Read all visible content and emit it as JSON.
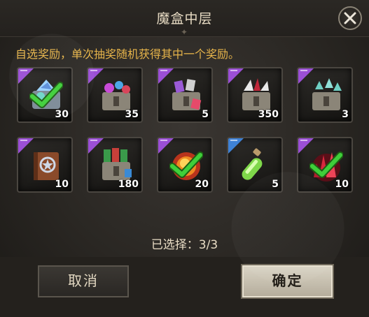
{
  "dialog": {
    "title": "魔盒中层",
    "description": "自选奖励，单次抽奖随机获得其中一个奖励。",
    "selected_count": "已选择：3/3"
  },
  "rewards": [
    {
      "quantity": "30",
      "selected": true,
      "rarity": "purple",
      "icon": "gem-chest-icon"
    },
    {
      "quantity": "35",
      "selected": false,
      "rarity": "purple",
      "icon": "crystal-chest-icon"
    },
    {
      "quantity": "5",
      "selected": false,
      "rarity": "purple",
      "icon": "card-chest-icon"
    },
    {
      "quantity": "350",
      "selected": false,
      "rarity": "purple",
      "icon": "feather-chest-icon"
    },
    {
      "quantity": "3",
      "selected": false,
      "rarity": "purple",
      "icon": "rune-chest-icon"
    },
    {
      "quantity": "10",
      "selected": false,
      "rarity": "purple",
      "icon": "spellbook-icon"
    },
    {
      "quantity": "180",
      "selected": false,
      "rarity": "purple",
      "icon": "banner-chest-icon"
    },
    {
      "quantity": "20",
      "selected": true,
      "rarity": "purple",
      "icon": "fire-orb-icon"
    },
    {
      "quantity": "5",
      "selected": false,
      "rarity": "blue",
      "icon": "potion-icon"
    },
    {
      "quantity": "10",
      "selected": true,
      "rarity": "purple",
      "icon": "red-crystal-icon"
    }
  ],
  "buttons": {
    "cancel_label": "取消",
    "confirm_label": "确定"
  },
  "colors": {
    "description_text": "#e6b44a",
    "rarity_purple": "#9b4fd6",
    "rarity_blue": "#3f82d6",
    "check_green": "#3fcf3a"
  }
}
